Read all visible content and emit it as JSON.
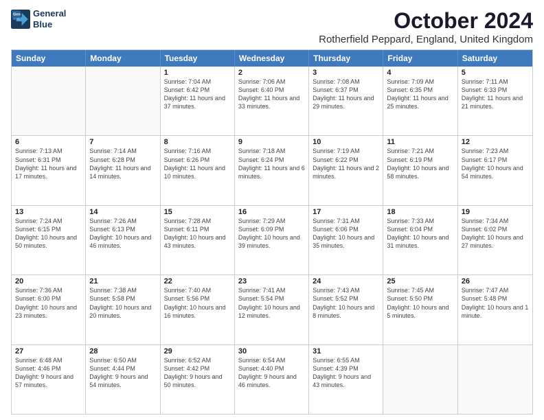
{
  "logo": {
    "line1": "General",
    "line2": "Blue"
  },
  "title": "October 2024",
  "location": "Rotherfield Peppard, England, United Kingdom",
  "days_of_week": [
    "Sunday",
    "Monday",
    "Tuesday",
    "Wednesday",
    "Thursday",
    "Friday",
    "Saturday"
  ],
  "weeks": [
    [
      {
        "day": "",
        "text": ""
      },
      {
        "day": "",
        "text": ""
      },
      {
        "day": "1",
        "text": "Sunrise: 7:04 AM\nSunset: 6:42 PM\nDaylight: 11 hours and 37 minutes."
      },
      {
        "day": "2",
        "text": "Sunrise: 7:06 AM\nSunset: 6:40 PM\nDaylight: 11 hours and 33 minutes."
      },
      {
        "day": "3",
        "text": "Sunrise: 7:08 AM\nSunset: 6:37 PM\nDaylight: 11 hours and 29 minutes."
      },
      {
        "day": "4",
        "text": "Sunrise: 7:09 AM\nSunset: 6:35 PM\nDaylight: 11 hours and 25 minutes."
      },
      {
        "day": "5",
        "text": "Sunrise: 7:11 AM\nSunset: 6:33 PM\nDaylight: 11 hours and 21 minutes."
      }
    ],
    [
      {
        "day": "6",
        "text": "Sunrise: 7:13 AM\nSunset: 6:31 PM\nDaylight: 11 hours and 17 minutes."
      },
      {
        "day": "7",
        "text": "Sunrise: 7:14 AM\nSunset: 6:28 PM\nDaylight: 11 hours and 14 minutes."
      },
      {
        "day": "8",
        "text": "Sunrise: 7:16 AM\nSunset: 6:26 PM\nDaylight: 11 hours and 10 minutes."
      },
      {
        "day": "9",
        "text": "Sunrise: 7:18 AM\nSunset: 6:24 PM\nDaylight: 11 hours and 6 minutes."
      },
      {
        "day": "10",
        "text": "Sunrise: 7:19 AM\nSunset: 6:22 PM\nDaylight: 11 hours and 2 minutes."
      },
      {
        "day": "11",
        "text": "Sunrise: 7:21 AM\nSunset: 6:19 PM\nDaylight: 10 hours and 58 minutes."
      },
      {
        "day": "12",
        "text": "Sunrise: 7:23 AM\nSunset: 6:17 PM\nDaylight: 10 hours and 54 minutes."
      }
    ],
    [
      {
        "day": "13",
        "text": "Sunrise: 7:24 AM\nSunset: 6:15 PM\nDaylight: 10 hours and 50 minutes."
      },
      {
        "day": "14",
        "text": "Sunrise: 7:26 AM\nSunset: 6:13 PM\nDaylight: 10 hours and 46 minutes."
      },
      {
        "day": "15",
        "text": "Sunrise: 7:28 AM\nSunset: 6:11 PM\nDaylight: 10 hours and 43 minutes."
      },
      {
        "day": "16",
        "text": "Sunrise: 7:29 AM\nSunset: 6:09 PM\nDaylight: 10 hours and 39 minutes."
      },
      {
        "day": "17",
        "text": "Sunrise: 7:31 AM\nSunset: 6:06 PM\nDaylight: 10 hours and 35 minutes."
      },
      {
        "day": "18",
        "text": "Sunrise: 7:33 AM\nSunset: 6:04 PM\nDaylight: 10 hours and 31 minutes."
      },
      {
        "day": "19",
        "text": "Sunrise: 7:34 AM\nSunset: 6:02 PM\nDaylight: 10 hours and 27 minutes."
      }
    ],
    [
      {
        "day": "20",
        "text": "Sunrise: 7:36 AM\nSunset: 6:00 PM\nDaylight: 10 hours and 23 minutes."
      },
      {
        "day": "21",
        "text": "Sunrise: 7:38 AM\nSunset: 5:58 PM\nDaylight: 10 hours and 20 minutes."
      },
      {
        "day": "22",
        "text": "Sunrise: 7:40 AM\nSunset: 5:56 PM\nDaylight: 10 hours and 16 minutes."
      },
      {
        "day": "23",
        "text": "Sunrise: 7:41 AM\nSunset: 5:54 PM\nDaylight: 10 hours and 12 minutes."
      },
      {
        "day": "24",
        "text": "Sunrise: 7:43 AM\nSunset: 5:52 PM\nDaylight: 10 hours and 8 minutes."
      },
      {
        "day": "25",
        "text": "Sunrise: 7:45 AM\nSunset: 5:50 PM\nDaylight: 10 hours and 5 minutes."
      },
      {
        "day": "26",
        "text": "Sunrise: 7:47 AM\nSunset: 5:48 PM\nDaylight: 10 hours and 1 minute."
      }
    ],
    [
      {
        "day": "27",
        "text": "Sunrise: 6:48 AM\nSunset: 4:46 PM\nDaylight: 9 hours and 57 minutes."
      },
      {
        "day": "28",
        "text": "Sunrise: 6:50 AM\nSunset: 4:44 PM\nDaylight: 9 hours and 54 minutes."
      },
      {
        "day": "29",
        "text": "Sunrise: 6:52 AM\nSunset: 4:42 PM\nDaylight: 9 hours and 50 minutes."
      },
      {
        "day": "30",
        "text": "Sunrise: 6:54 AM\nSunset: 4:40 PM\nDaylight: 9 hours and 46 minutes."
      },
      {
        "day": "31",
        "text": "Sunrise: 6:55 AM\nSunset: 4:39 PM\nDaylight: 9 hours and 43 minutes."
      },
      {
        "day": "",
        "text": ""
      },
      {
        "day": "",
        "text": ""
      }
    ]
  ]
}
